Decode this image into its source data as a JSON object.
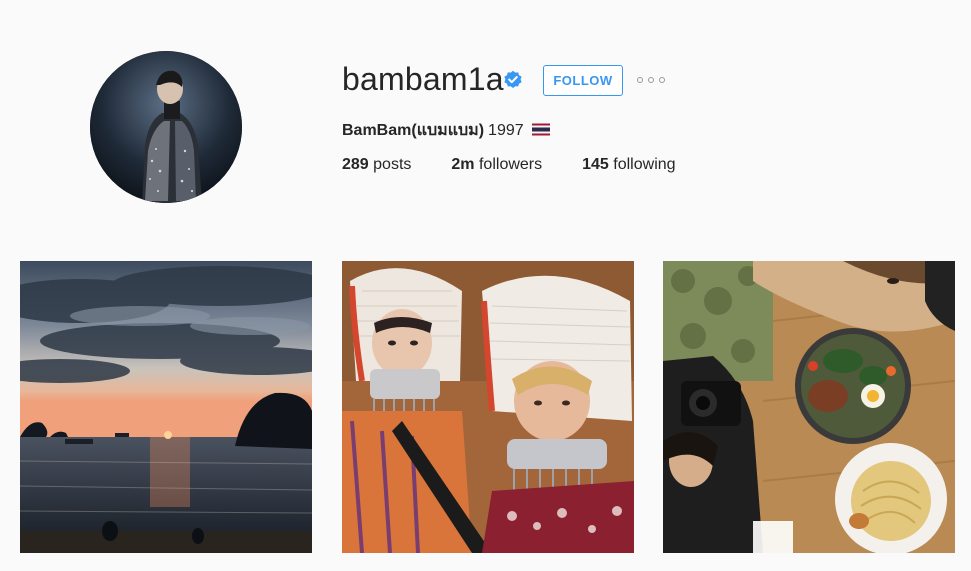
{
  "profile": {
    "username": "bambam1a",
    "verified": true,
    "follow_label": "FOLLOW",
    "full_name": "BamBam(แบมแบม)",
    "bio_year": "1997",
    "flag": "thailand-flag",
    "stats": {
      "posts_count": "289",
      "posts_label": "posts",
      "followers_count": "2m",
      "followers_label": "followers",
      "following_count": "145",
      "following_label": "following"
    }
  },
  "colors": {
    "accent": "#3897f0",
    "background": "#fafafa",
    "text": "#262626"
  },
  "posts": [
    {
      "icon": "sunset-beach-photo"
    },
    {
      "icon": "hill-tribe-costume-selfie-photo"
    },
    {
      "icon": "food-table-selfie-photo"
    }
  ]
}
